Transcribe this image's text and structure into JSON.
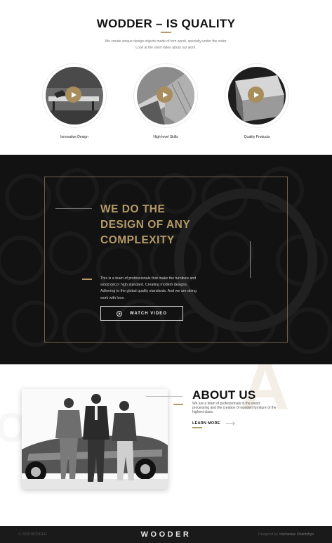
{
  "quality": {
    "title": "WODDER – IS QUALITY",
    "description_line1": "We create unique design objects made of torn wood, specially under the order.",
    "description_line2": "Look at the short video about our work.",
    "items": [
      {
        "label": "Innovative Design"
      },
      {
        "label": "High-level Skills"
      },
      {
        "label": "Quality Products"
      }
    ]
  },
  "design": {
    "title": "WE DO THE DESIGN OF ANY COMPLEXITY",
    "text": "This is a team of professionals that make the furniture and wood décor high standard. Creating modern designs. Adhering to the global quality standards. And we are doing work with love.",
    "button_label": "WATCH VIDEO"
  },
  "about": {
    "title": "ABOUT US",
    "text": "We are a team of professionals in the wood processing and the creation of wooden furniture of the highest class.",
    "learn_more": "LEARN MORE"
  },
  "footer": {
    "copyright": "© 2018 WOODER",
    "logo": "WOODER",
    "credit_prefix": "Designed by",
    "credit_name": "Viacheslav Obantshyn"
  },
  "colors": {
    "accent": "#b59a68",
    "dark": "#141414",
    "footer": "#1a1a1a"
  },
  "icons": [
    "play-icon",
    "watch-video-play-icon",
    "arrow-right-icon"
  ]
}
